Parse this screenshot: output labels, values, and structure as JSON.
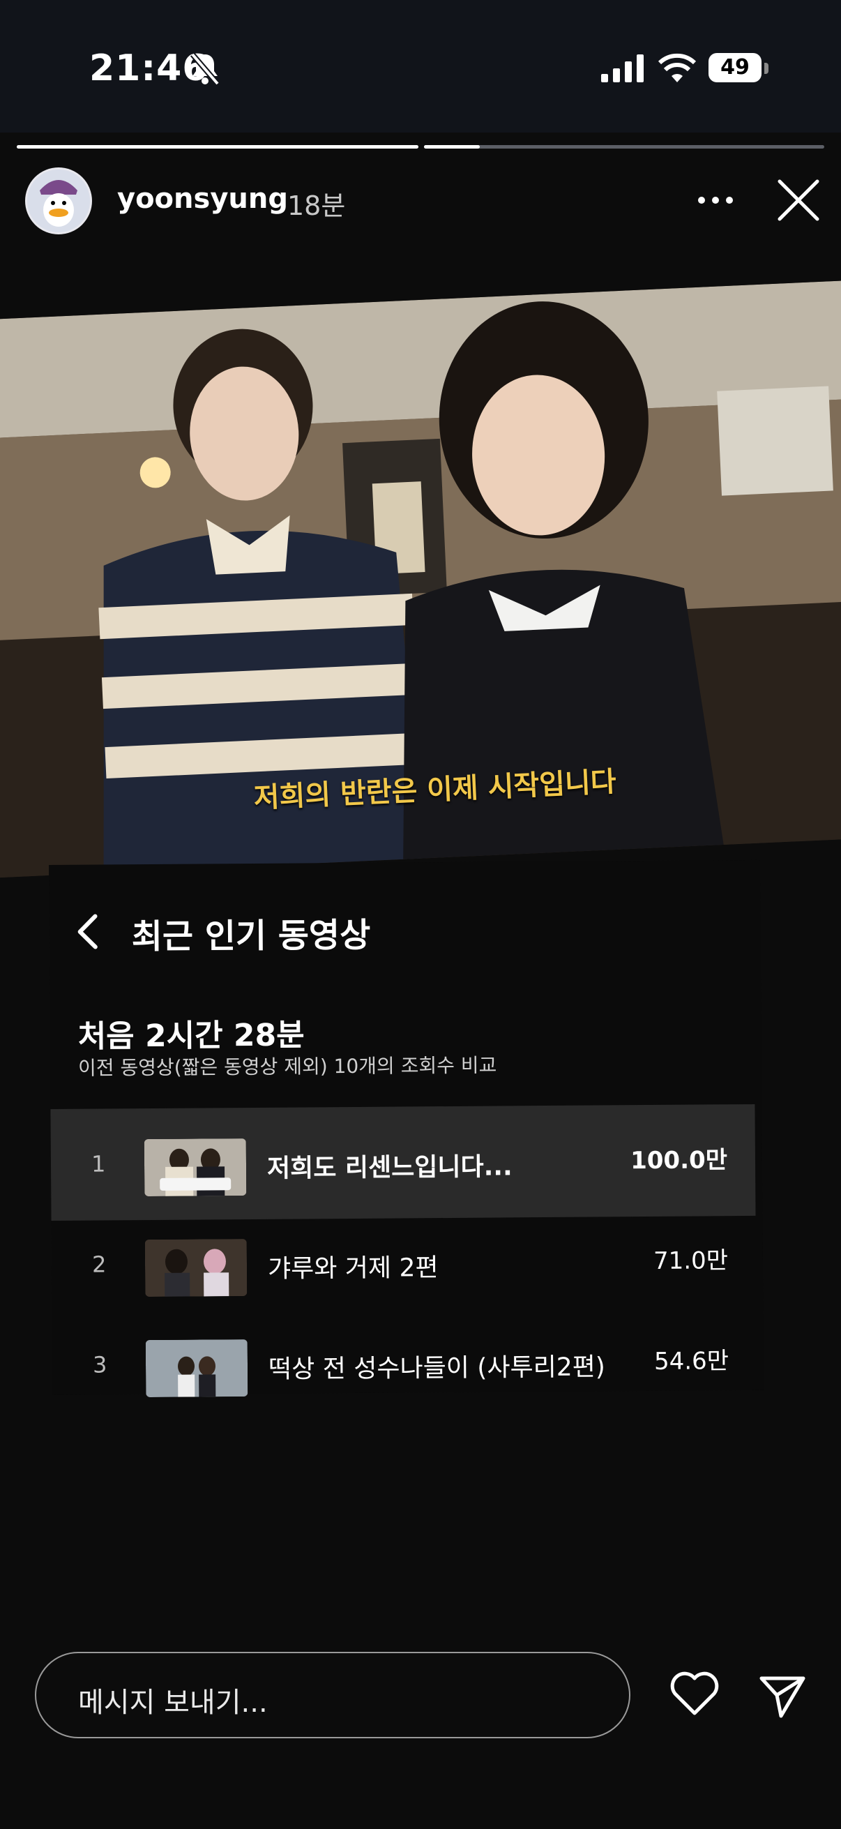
{
  "status_bar": {
    "time": "21:46",
    "battery": "49"
  },
  "story": {
    "username": "yoonsyung",
    "time_ago": "18분",
    "progress": [
      1.0,
      0.14
    ]
  },
  "photo": {
    "caption": "저희의 반란은 이제 시작입니다"
  },
  "panel": {
    "title": "최근 인기 동영상",
    "heading": "처음 2시간 28분",
    "subheading": "이전 동영상(짧은 동영상 제외) 10개의 조회수 비교",
    "videos": [
      {
        "rank": "1",
        "title": "저희도 리센느입니다...",
        "views": "100.0만"
      },
      {
        "rank": "2",
        "title": "갸루와 거제 2편",
        "views": "71.0만"
      },
      {
        "rank": "3",
        "title": "떡상 전 성수나들이 (사투리2편)",
        "views": "54.6만"
      }
    ]
  },
  "bottom_bar": {
    "message_placeholder": "메시지 보내기..."
  },
  "icons": {
    "bell_muted": "bell-slash-icon",
    "signal": "signal-icon",
    "wifi": "wifi-icon",
    "more": "more-dots-icon",
    "close": "close-icon",
    "back": "chevron-left-icon",
    "heart": "heart-icon",
    "send": "send-icon"
  }
}
